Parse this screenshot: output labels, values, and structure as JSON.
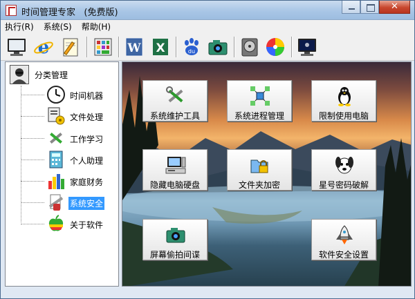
{
  "window": {
    "title": "时间管理专家   (免费版)",
    "close_symbol": "✕"
  },
  "menu": [
    "执行(R)",
    "系统(S)",
    "帮助(H)"
  ],
  "toolbar": [
    {
      "icon": "monitor-icon"
    },
    {
      "icon": "internet-explorer-icon"
    },
    {
      "icon": "notepad-pencil-icon"
    },
    {
      "icon": "calculator-panel-icon"
    },
    {
      "icon": "word-icon"
    },
    {
      "icon": "excel-icon"
    },
    {
      "icon": "baidu-paw-icon"
    },
    {
      "icon": "camera-icon"
    },
    {
      "icon": "disc-drive-icon"
    },
    {
      "icon": "cd-rainbow-icon"
    },
    {
      "icon": "display-icon"
    }
  ],
  "tree": {
    "root": "分类管理",
    "items": [
      "时间机器",
      "文件处理",
      "工作学习",
      "个人助理",
      "家庭财务",
      "系统安全",
      "关于软件"
    ],
    "selected_index": 5
  },
  "tiles": [
    {
      "label": "系统维护工具",
      "icon": "wrench-screwdriver-icon"
    },
    {
      "label": "系统进程管理",
      "icon": "process-network-icon"
    },
    {
      "label": "限制使用电脑",
      "icon": "penguin-icon"
    },
    {
      "label": "隐藏电脑硬盘",
      "icon": "computer-hdd-icon"
    },
    {
      "label": "文件夹加密",
      "icon": "folder-lock-icon"
    },
    {
      "label": "星号密码破解",
      "icon": "dog-icon"
    },
    {
      "label": "屏幕偷拍间谍",
      "icon": "spy-camera-icon"
    },
    {
      "label": "软件安全设置",
      "icon": "rocket-icon"
    }
  ],
  "colors": {
    "selection": "#3399ff",
    "titlebar": "#a9c6e6",
    "close": "#c8472e"
  }
}
